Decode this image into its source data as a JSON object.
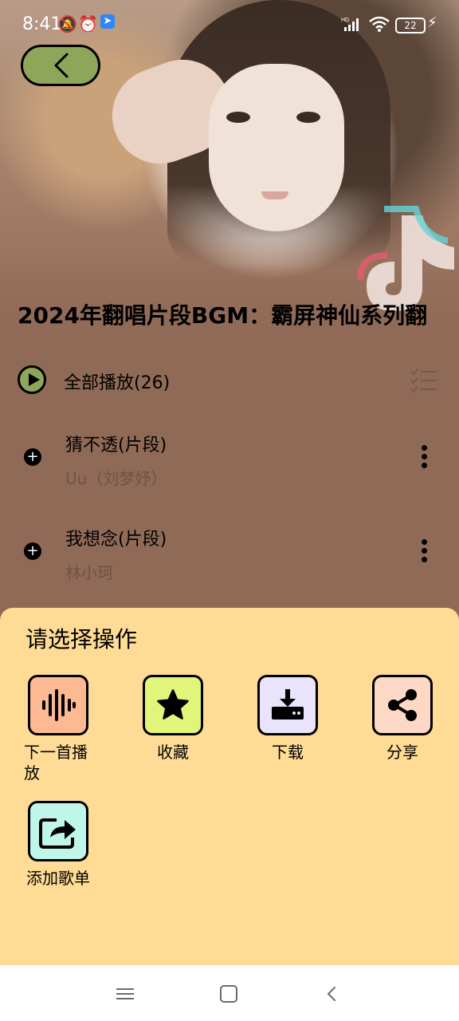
{
  "status_bar": {
    "time": "8:41",
    "battery": "22",
    "icons": [
      "mute-bell-icon",
      "alarm-icon",
      "app-badge-icon",
      "hd-signal-icon",
      "wifi-icon",
      "battery-icon",
      "charging-icon"
    ]
  },
  "header": {
    "back_icon": "chevron-left-icon",
    "accent_color": "#8ea65a"
  },
  "playlist": {
    "title": "2024年翻唱片段BGM：霸屏神仙系列翻",
    "play_all_label": "全部播放(26)",
    "songs": [
      {
        "title": "猜不透(片段)",
        "artist": "Uu（刘梦妤）"
      },
      {
        "title": "我想念(片段)",
        "artist": "林小珂"
      }
    ]
  },
  "sheet": {
    "title": "请选择操作",
    "background": "#fedc96",
    "actions": [
      {
        "label": "下一首播放",
        "icon": "audio-wave-icon",
        "color": "#fdb991"
      },
      {
        "label": "收藏",
        "icon": "star-icon",
        "color": "#e0f57a"
      },
      {
        "label": "下载",
        "icon": "download-icon",
        "color": "#e9e3fb"
      },
      {
        "label": "分享",
        "icon": "share-icon",
        "color": "#fdd8c4"
      },
      {
        "label": "添加歌单",
        "icon": "add-to-playlist-icon",
        "color": "#bff6e9"
      }
    ]
  },
  "navbar": {
    "icons": [
      "menu-icon",
      "home-icon",
      "back-icon"
    ]
  }
}
